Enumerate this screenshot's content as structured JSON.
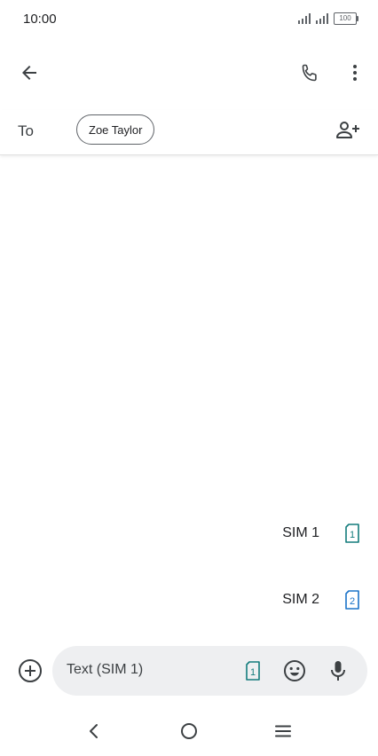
{
  "status_bar": {
    "time": "10:00",
    "battery": "100"
  },
  "app_bar": {
    "back_icon": "arrow-back-icon",
    "call_icon": "phone-icon",
    "more_icon": "more-vert-icon"
  },
  "recipient": {
    "to_label": "To",
    "chip_name": "Zoe Taylor",
    "add_icon": "add-person-icon"
  },
  "sim_picker": {
    "options": [
      {
        "label": "SIM 1",
        "badge": "1",
        "color": "#137c7c"
      },
      {
        "label": "SIM 2",
        "badge": "2",
        "color": "#1a73c8"
      }
    ]
  },
  "compose": {
    "placeholder": "Text (SIM 1)",
    "sim_badge": "1",
    "sim_color": "#137c7c"
  },
  "nav": {
    "back_icon": "nav-back-icon",
    "home_icon": "nav-home-icon",
    "menu_icon": "nav-menu-icon"
  },
  "colors": {
    "icon": "#3c4043",
    "field_bg": "#eeeff1"
  }
}
